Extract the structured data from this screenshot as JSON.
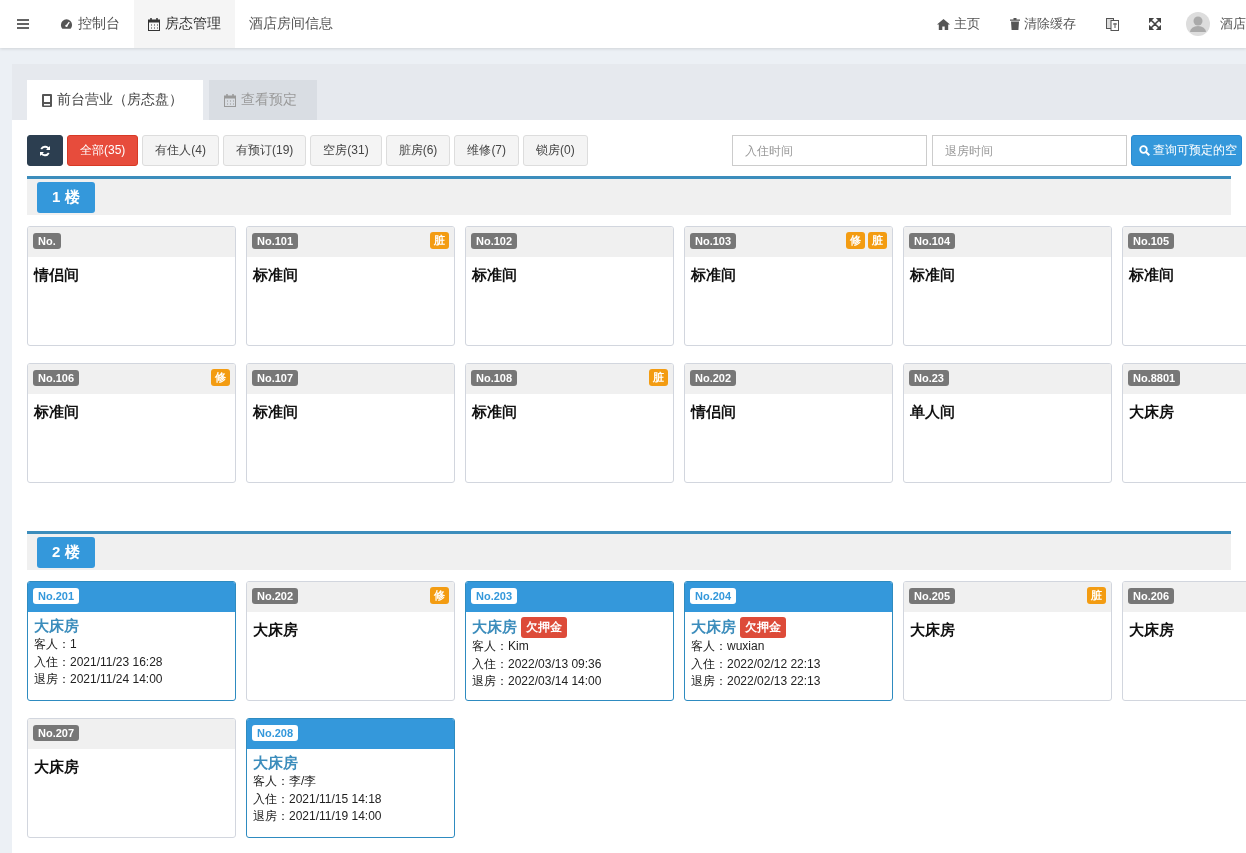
{
  "navbar": {
    "items": [
      {
        "label": "控制台",
        "selected": false
      },
      {
        "label": "房态管理",
        "selected": true
      },
      {
        "label": "酒店房间信息",
        "selected": false
      }
    ],
    "links": [
      "主页",
      "清除缓存"
    ],
    "user": "酒店"
  },
  "tabs": [
    {
      "label": "前台营业（房态盘）",
      "selected": true
    },
    {
      "label": "查看预定",
      "selected": false
    }
  ],
  "filters": [
    {
      "kind": "refresh"
    },
    {
      "kind": "filter",
      "label": "全部(35)",
      "selected": true
    },
    {
      "kind": "filter",
      "label": "有住人(4)",
      "selected": false
    },
    {
      "kind": "filter",
      "label": "有预订(19)",
      "selected": false
    },
    {
      "kind": "filter",
      "label": "空房(31)",
      "selected": false
    },
    {
      "kind": "filter",
      "label": "脏房(6)",
      "selected": false
    },
    {
      "kind": "filter",
      "label": "维修(7)",
      "selected": false
    },
    {
      "kind": "filter",
      "label": "锁房(0)",
      "selected": false
    }
  ],
  "search": {
    "checkin_placeholder": "入住时间",
    "checkout_placeholder": "退房时间",
    "button": "查询可预定的空"
  },
  "floors": [
    {
      "label": "1 楼",
      "rooms": [
        {
          "number": "No.",
          "type": "情侣间",
          "occupied": false
        },
        {
          "number": "No.101",
          "type": "标准间",
          "occupied": false,
          "tags": [
            "脏"
          ]
        },
        {
          "number": "No.102",
          "type": "标准间",
          "occupied": false
        },
        {
          "number": "No.103",
          "type": "标准间",
          "occupied": false,
          "tags": [
            "修",
            "脏"
          ]
        },
        {
          "number": "No.104",
          "type": "标准间",
          "occupied": false
        },
        {
          "number": "No.105",
          "type": "标准间",
          "occupied": false
        },
        {
          "number": "No.106",
          "type": "标准间",
          "occupied": false,
          "tags": [
            "修"
          ]
        },
        {
          "number": "No.107",
          "type": "标准间",
          "occupied": false
        },
        {
          "number": "No.108",
          "type": "标准间",
          "occupied": false,
          "tags": [
            "脏"
          ]
        },
        {
          "number": "No.202",
          "type": "情侣间",
          "occupied": false
        },
        {
          "number": "No.23",
          "type": "单人间",
          "occupied": false
        },
        {
          "number": "No.8801",
          "type": "大床房",
          "occupied": false
        }
      ]
    },
    {
      "label": "2 楼",
      "rooms": [
        {
          "number": "No.201",
          "type": "大床房",
          "occupied": true,
          "lines": [
            "客人：1",
            "入住：2021/11/23 16:28",
            "退房：2021/11/24 14:00"
          ]
        },
        {
          "number": "No.202",
          "type": "大床房",
          "occupied": false,
          "tags": [
            "修"
          ]
        },
        {
          "number": "No.203",
          "type": "大床房",
          "occupied": true,
          "alert": "欠押金",
          "lines": [
            "客人：Kim",
            "入住：2022/03/13 09:36",
            "退房：2022/03/14 14:00"
          ]
        },
        {
          "number": "No.204",
          "type": "大床房",
          "occupied": true,
          "alert": "欠押金",
          "lines": [
            "客人：wuxian",
            "入住：2022/02/12 22:13",
            "退房：2022/02/13 22:13"
          ]
        },
        {
          "number": "No.205",
          "type": "大床房",
          "occupied": false,
          "tags": [
            "脏"
          ]
        },
        {
          "number": "No.206",
          "type": "大床房",
          "occupied": false
        },
        {
          "number": "No.207",
          "type": "大床房",
          "occupied": false
        },
        {
          "number": "No.208",
          "type": "大床房",
          "occupied": true,
          "lines": [
            "客人：李/李",
            "入住：2021/11/15 14:18",
            "退房：2021/11/19 14:00"
          ]
        }
      ]
    }
  ]
}
